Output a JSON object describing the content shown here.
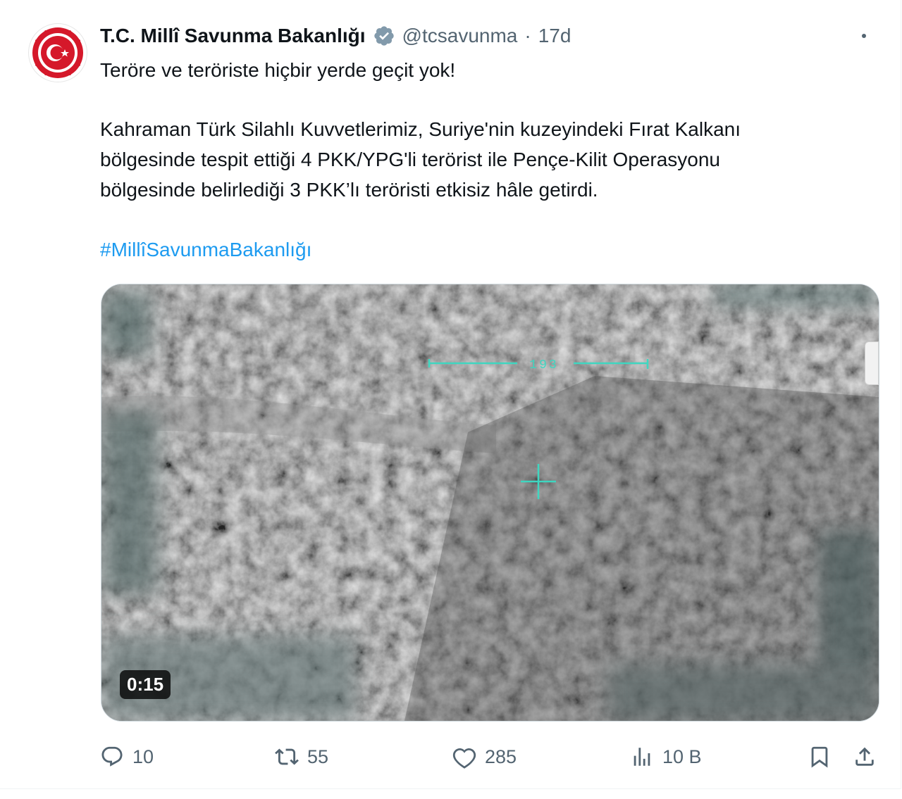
{
  "tweet": {
    "display_name": "T.C. Millî Savunma Bakanlığı",
    "handle": "@tcsavunma",
    "separator": "·",
    "time": "17d",
    "text_line1": "Teröre ve teröriste hiçbir yerde geçit yok!",
    "paragraph2": [
      "Kahraman Türk Silahlı Kuvvetlerimiz, Suriye'nin kuzeyindeki Fırat Kalkanı",
      "bölgesinde tespit ettiği 4 PKK/YPG'li terörist ile Pençe-Kilit Operasyonu",
      "bölgesinde belirlediği 3 PKK’lı teröristi etkisiz hâle getirdi."
    ],
    "hashtag": "#MillîSavunmaBakanlığı"
  },
  "video": {
    "duration": "0:15",
    "hud_reading": "193",
    "hud_color": "#3fd6c0"
  },
  "actions": {
    "replies": "10",
    "reposts": "55",
    "likes": "285",
    "views": "10 B"
  },
  "colors": {
    "text": "#0f1419",
    "muted": "#536471",
    "link": "#1d9bf0",
    "verified": "#829aab",
    "avatar_red": "#d5182a"
  },
  "icons": {
    "avatar": "ministry-emblem-icon",
    "verified": "verified-badge-icon",
    "more": "more-icon",
    "reply": "reply-icon",
    "repost": "repost-icon",
    "like": "heart-icon",
    "views": "views-icon",
    "bookmark": "bookmark-icon",
    "share": "share-icon"
  }
}
